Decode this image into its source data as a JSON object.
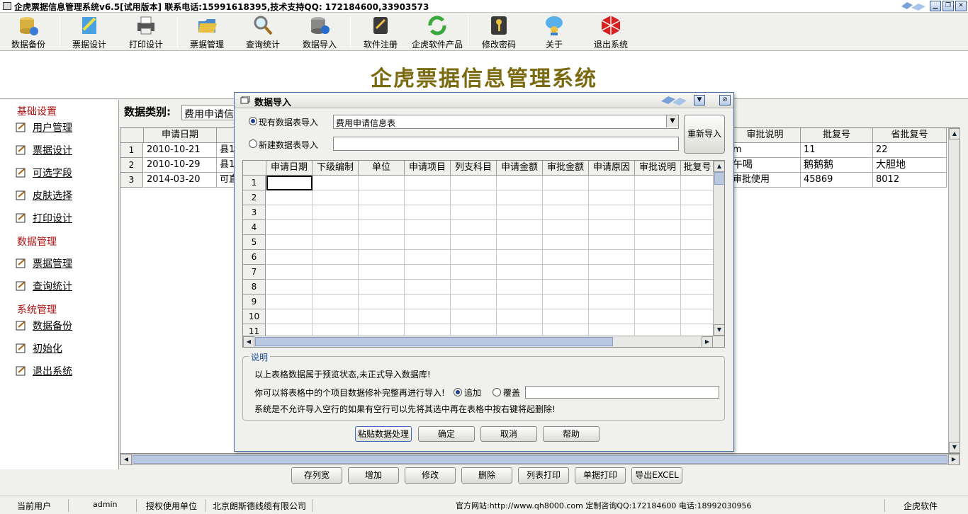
{
  "window": {
    "title": "企虎票据信息管理系统v6.5[试用版本]   联系电话:15991618395,技术支持QQ: 172184600,33903573",
    "min_label": "▁",
    "restore_label": "❐"
  },
  "toolbar": {
    "items": [
      {
        "label": "数据备份",
        "icon": "database-backup-icon"
      },
      {
        "label": "票据设计",
        "icon": "design-icon"
      },
      {
        "label": "打印设计",
        "icon": "printer-icon"
      },
      {
        "label": "票据管理",
        "icon": "folder-icon"
      },
      {
        "label": "查询统计",
        "icon": "magnifier-icon"
      },
      {
        "label": "数据导入",
        "icon": "database-import-icon"
      },
      {
        "label": "软件注册",
        "icon": "register-icon"
      },
      {
        "label": "企虎软件产品",
        "icon": "refresh-icon"
      },
      {
        "label": "修改密码",
        "icon": "key-icon"
      },
      {
        "label": "关于",
        "icon": "about-icon"
      },
      {
        "label": "退出系统",
        "icon": "exit-icon"
      }
    ]
  },
  "banner": {
    "title": "企虎票据信息管理系统"
  },
  "sidebar": {
    "groups": [
      {
        "title": "基础设置",
        "items": [
          "用户管理",
          "票据设计",
          "可选字段",
          "皮肤选择",
          "打印设计"
        ]
      },
      {
        "title": "数据管理",
        "items": [
          "票据管理",
          "查询统计"
        ]
      },
      {
        "title": "系统管理",
        "items": [
          "数据备份",
          "初始化",
          "退出系统"
        ]
      }
    ]
  },
  "main": {
    "category_label": "数据类别:",
    "category_value": "费用申请信",
    "table": {
      "left_headers": [
        "申请日期"
      ],
      "right_headers": [
        "审批说明",
        "批复号",
        "省批复号"
      ],
      "rows": [
        {
          "num": "1",
          "date": "2010-10-21",
          "c2": "县1",
          "memo": "m",
          "reply": "11",
          "prov": "22"
        },
        {
          "num": "2",
          "date": "2010-10-29",
          "c2": "县1",
          "memo": "午喝",
          "reply": "鹅鹅鹅",
          "prov": "大胆地"
        },
        {
          "num": "3",
          "date": "2014-03-20",
          "c2": "可直",
          "memo": "审批使用",
          "reply": "45869",
          "prov": "8012"
        }
      ]
    }
  },
  "bottom_buttons": [
    "存列宽",
    "增加",
    "修改",
    "删除",
    "列表打印",
    "单据打印",
    "导出EXCEL"
  ],
  "statusbar": {
    "user_label": "当前用户",
    "user_value": "admin",
    "unit_label": "授权使用单位",
    "unit_value": "北京朗斯德线缆有限公司",
    "info": "官方网站:http://www.qh8000.com 定制咨询QQ:172184600 电话:18992030956",
    "brand": "企虎软件"
  },
  "dialog": {
    "title": "数据导入",
    "radio_existing": "现有数据表导入",
    "radio_new": "新建数据表导入",
    "existing_table": "费用申请信息表",
    "new_table_value": "",
    "reimport_button": "重新导入",
    "grid_headers": [
      "申请日期",
      "下级编制",
      "单位",
      "申请项目",
      "列支科目",
      "申请金额",
      "审批金额",
      "申请原因",
      "审批说明",
      "批复号"
    ],
    "row_numbers": [
      "1",
      "2",
      "3",
      "4",
      "5",
      "6",
      "7",
      "8",
      "9",
      "10",
      "11"
    ],
    "note_title": "说明",
    "note_line1": "以上表格数据属于预览状态,未正式导入数据库!",
    "note_line2": "你可以将表格中的个项目数据修补完整再进行导入!",
    "opt_append": "追加",
    "opt_cover": "覆盖",
    "opt_input": "",
    "note_line3": "系统是不允许导入空行的如果有空行可以先将其选中再在表格中按右键将起删除!",
    "buttons": [
      "粘贴数据处理",
      "确定",
      "取消",
      "帮助"
    ]
  }
}
